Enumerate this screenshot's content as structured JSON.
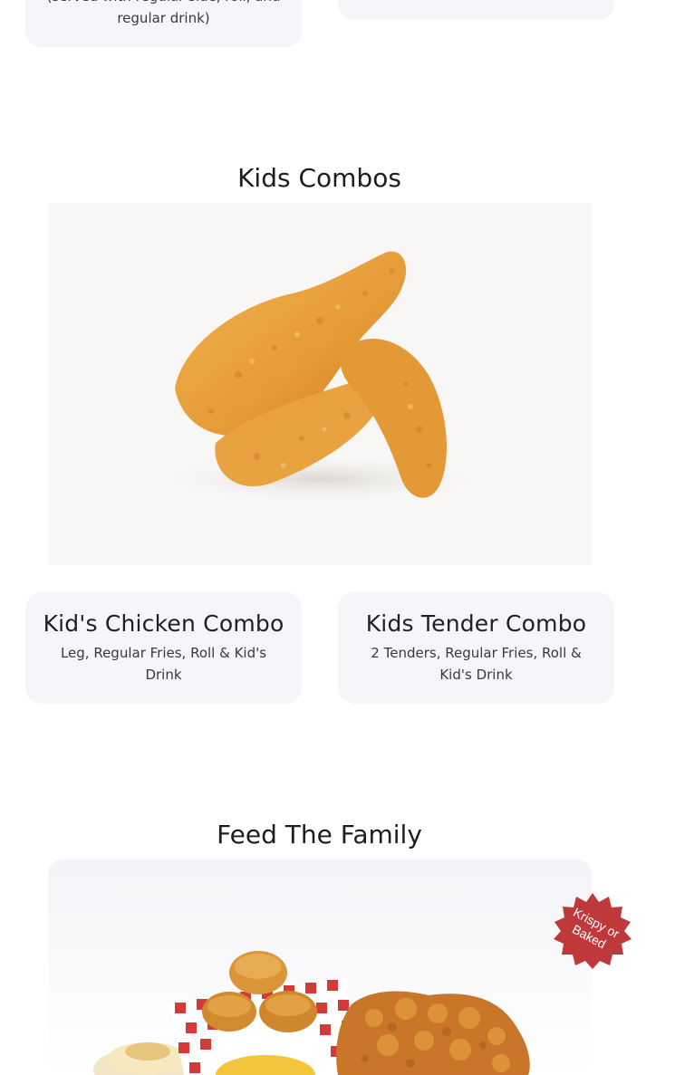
{
  "top_cards": {
    "left_desc_tail": "(served with regular side, roll, and regular drink)"
  },
  "sections": [
    {
      "title": "Kids Combos",
      "image_alt": "fried chicken leg and tenders",
      "items": [
        {
          "name": "Kid's Chicken Combo",
          "desc": "Leg, Regular Fries, Roll & Kid's Drink"
        },
        {
          "name": "Kids Tender Combo",
          "desc": "2 Tenders, Regular Fries, Roll & Kid's Drink"
        }
      ]
    },
    {
      "title": "Feed The Family",
      "badge": "Krispy or Baked",
      "image_alt": "family meal with rolls, chicken and sides"
    }
  ],
  "colors": {
    "card_bg": "#f5f5fa",
    "badge": "#c0393a"
  }
}
